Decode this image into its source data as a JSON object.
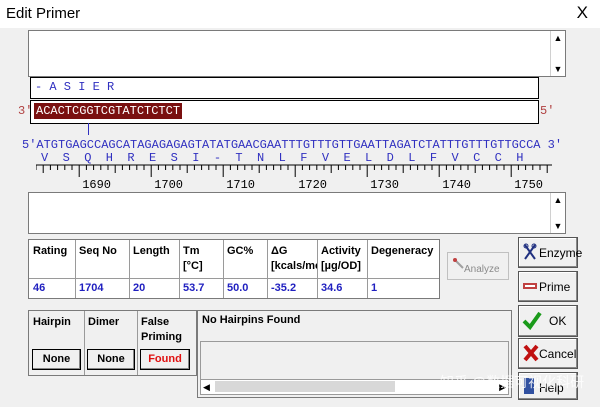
{
  "window": {
    "title": "Edit Primer",
    "close_glyph": "X"
  },
  "amino_top": "- A S I E R",
  "primer": {
    "left_label": "3'",
    "right_label": "5'",
    "sequence": "ACACTCGGTCGTATCTCTCT"
  },
  "template": {
    "sequence": "5'ATGTGAGCCAGCATAGAGAGAGTATATGAACGAATTTGTTTGTTGAATTAGATCTATTTGTTTGTTGCCA 3'",
    "translation": "V  S  Q  H  R  E  S  I  -  T  N  L  F  V  E  L  D  L  F  V  C  C  H"
  },
  "ruler": {
    "ticks": [
      "1690",
      "1700",
      "1710",
      "1720",
      "1730",
      "1740",
      "1750"
    ]
  },
  "properties": {
    "headers": [
      "Rating",
      "Seq No",
      "Length",
      "Tm\n[°C]",
      "GC%",
      "ΔG\n[kcals/mo",
      "Activity\n[µg/OD]",
      "Degeneracy"
    ],
    "values": [
      "46",
      "1704",
      "20",
      "53.7",
      "50.0",
      "-35.2",
      "34.6",
      "1"
    ]
  },
  "buttons": {
    "analyze": "Analyze",
    "enzyme": "Enzyme",
    "prime": "Prime",
    "ok": "OK",
    "cancel": "Cancel",
    "help": "Help"
  },
  "checks": {
    "hairpin": {
      "label": "Hairpin",
      "result": "None"
    },
    "dimer": {
      "label": "Dimer",
      "result": "None"
    },
    "false_priming": {
      "label": "False\nPriming",
      "result": "Found"
    }
  },
  "message": "No Hairpins Found",
  "watermark": "知乎 @数据可视化科研"
}
